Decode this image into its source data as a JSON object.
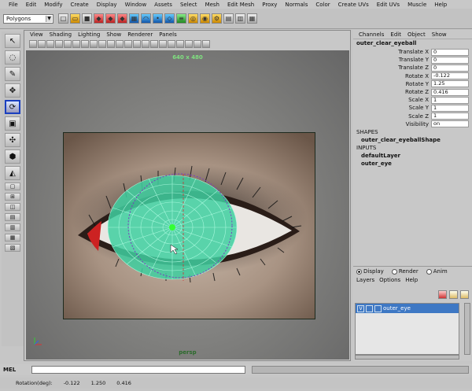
{
  "menubar": {
    "items": [
      "File",
      "Edit",
      "Modify",
      "Create",
      "Display",
      "Window",
      "Assets",
      "Select",
      "Mesh",
      "Edit Mesh",
      "Proxy",
      "Normals",
      "Color",
      "Create UVs",
      "Edit UVs",
      "Muscle",
      "Help"
    ]
  },
  "shelf": {
    "mode_value": "Polygons"
  },
  "viewport": {
    "menu": [
      "View",
      "Shading",
      "Lighting",
      "Show",
      "Renderer",
      "Panels"
    ],
    "resolution_gate": "640 x 480",
    "camera_label": "persp"
  },
  "channel_box": {
    "tabs": [
      "Channels",
      "Edit",
      "Object",
      "Show"
    ],
    "node_name": "outer_clear_eyeball",
    "attributes": [
      {
        "name": "Translate X",
        "value": "0"
      },
      {
        "name": "Translate Y",
        "value": "0"
      },
      {
        "name": "Translate Z",
        "value": "0"
      },
      {
        "name": "Rotate X",
        "value": "-0.122"
      },
      {
        "name": "Rotate Y",
        "value": "1.25"
      },
      {
        "name": "Rotate Z",
        "value": "0.416"
      },
      {
        "name": "Scale X",
        "value": "1"
      },
      {
        "name": "Scale Y",
        "value": "1"
      },
      {
        "name": "Scale Z",
        "value": "1"
      },
      {
        "name": "Visibility",
        "value": "on"
      }
    ],
    "shapes_header": "SHAPES",
    "shape_node": "outer_clear_eyeballShape",
    "inputs_header": "INPUTS",
    "input_nodes": [
      "defaultLayer",
      "outer_eye"
    ]
  },
  "layer_editor": {
    "radio_options": [
      "Display",
      "Render",
      "Anim"
    ],
    "selected_option": "Display",
    "menu": [
      "Layers",
      "Options",
      "Help"
    ],
    "layers": [
      {
        "vis": "V",
        "name": "outer_eye"
      }
    ]
  },
  "command_line": {
    "label": "MEL"
  },
  "help_line": {
    "items": [
      "Rotation(deg):",
      "-0.122",
      "1.250",
      "0.416"
    ]
  }
}
